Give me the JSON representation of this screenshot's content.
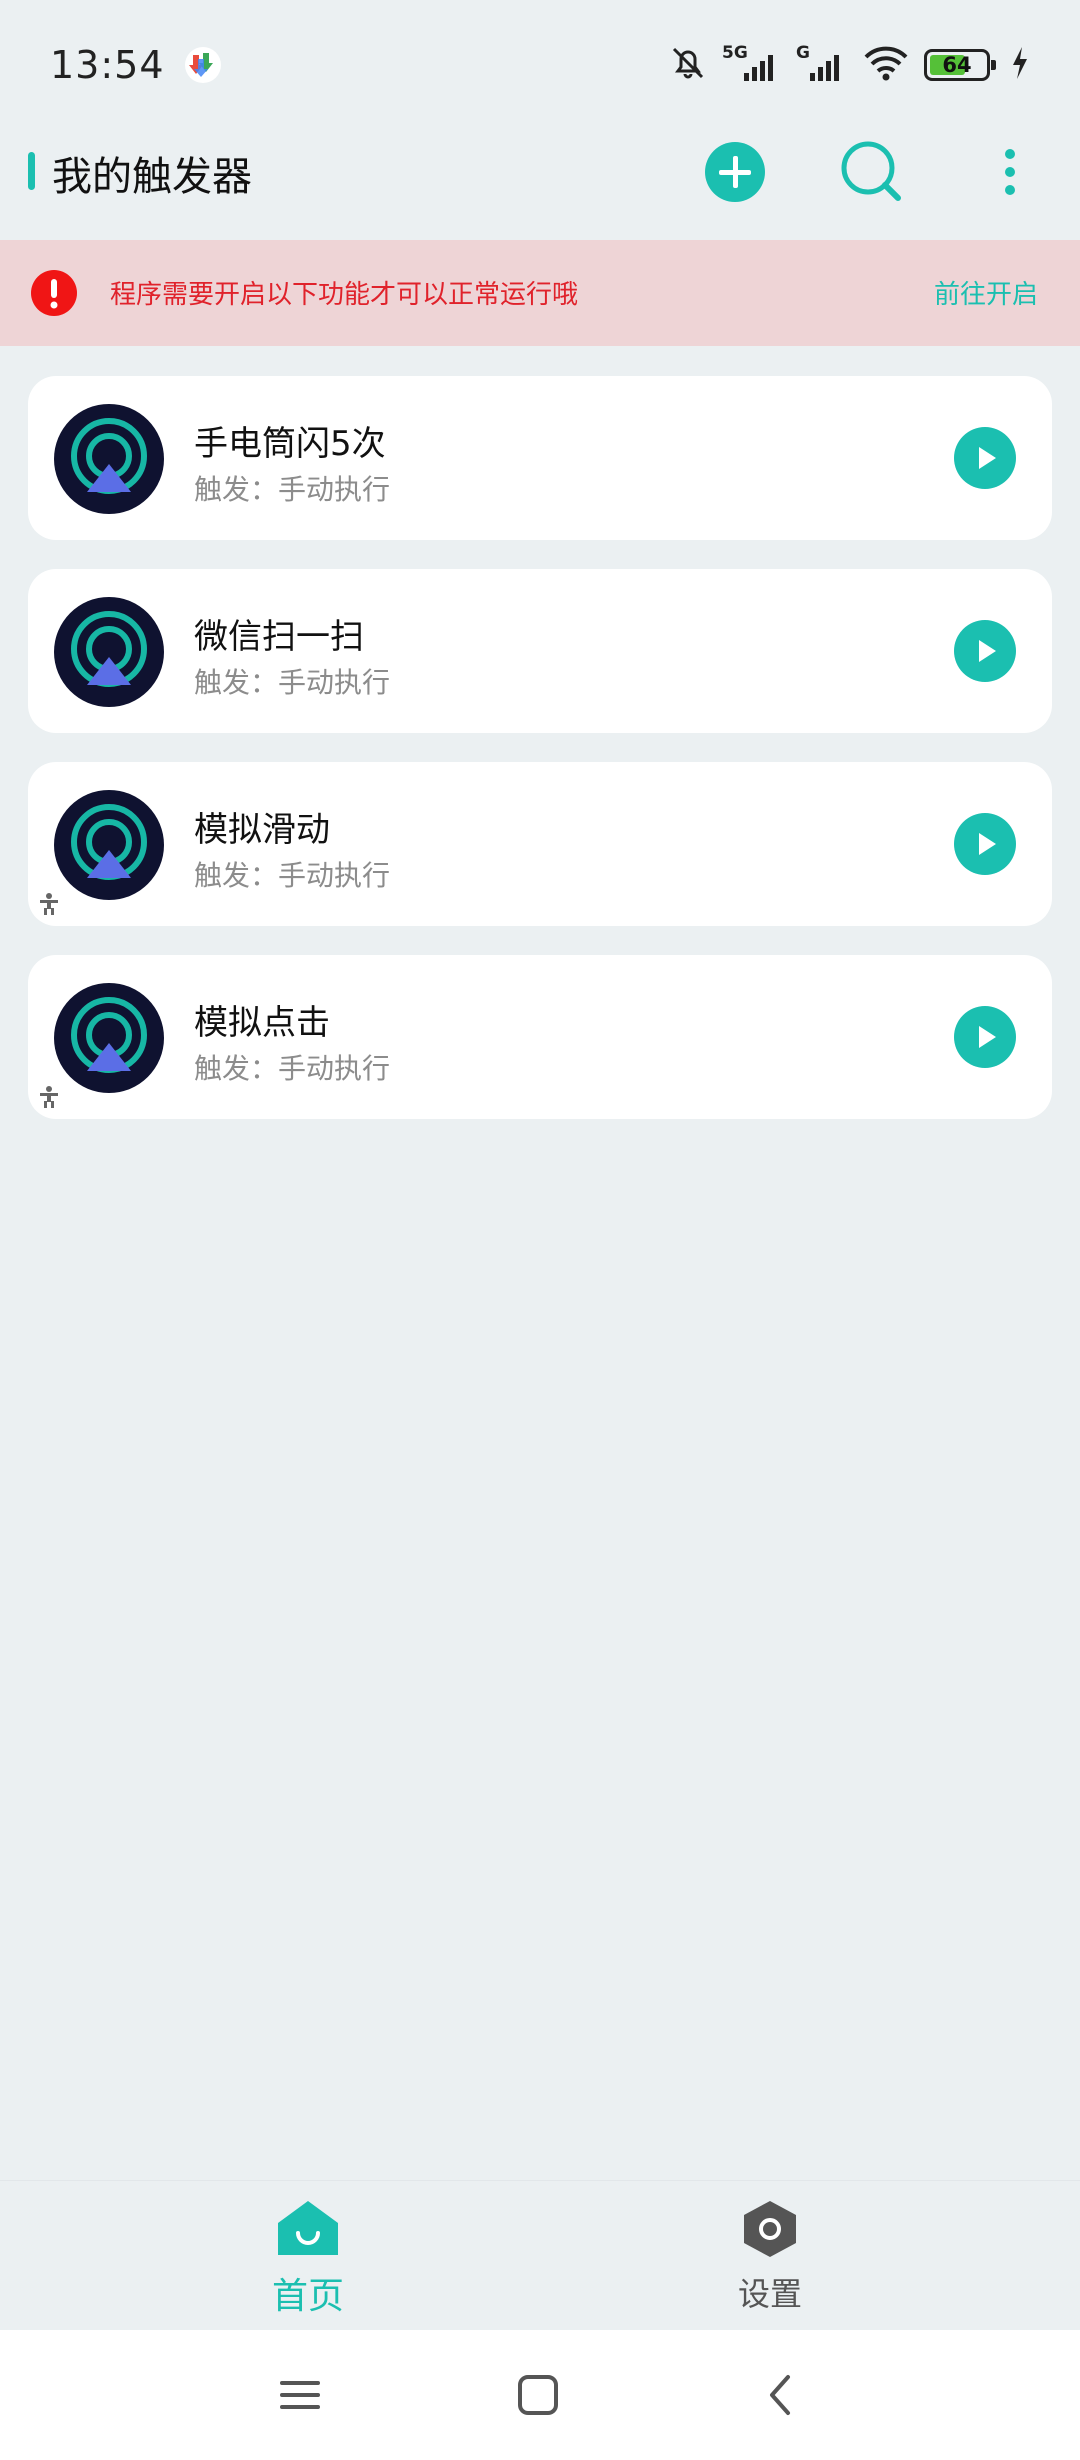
{
  "status_bar": {
    "time": "13:54",
    "signal_1_label": "5G",
    "signal_2_label": "G",
    "battery_level": "64",
    "icons": [
      "downloader-app-icon",
      "mute-bell-icon",
      "signal-5g-icon",
      "signal-g-icon",
      "wifi-icon",
      "battery-icon",
      "charging-icon"
    ]
  },
  "app_bar": {
    "title": "我的触发器",
    "actions": [
      "add-icon",
      "search-icon",
      "more-vert-icon"
    ]
  },
  "banner": {
    "message": "程序需要开启以下功能才可以正常运行哦",
    "action": "前往开启",
    "icon": "alert-icon"
  },
  "triggers": [
    {
      "title": "手电筒闪5次",
      "subtitle": "触发：手动执行",
      "accessibility": false
    },
    {
      "title": "微信扫一扫",
      "subtitle": "触发：手动执行",
      "accessibility": false
    },
    {
      "title": "模拟滑动",
      "subtitle": "触发：手动执行",
      "accessibility": true
    },
    {
      "title": "模拟点击",
      "subtitle": "触发：手动执行",
      "accessibility": true
    }
  ],
  "bottom_nav": {
    "items": [
      {
        "label": "首页",
        "icon": "home-icon",
        "active": true
      },
      {
        "label": "设置",
        "icon": "settings-hex-icon",
        "active": false
      }
    ]
  },
  "colors": {
    "accent": "#1bbfb0",
    "warning_text": "#e0222b",
    "banner_bg": "#eed4d6",
    "page_bg": "#ebf0f2"
  }
}
